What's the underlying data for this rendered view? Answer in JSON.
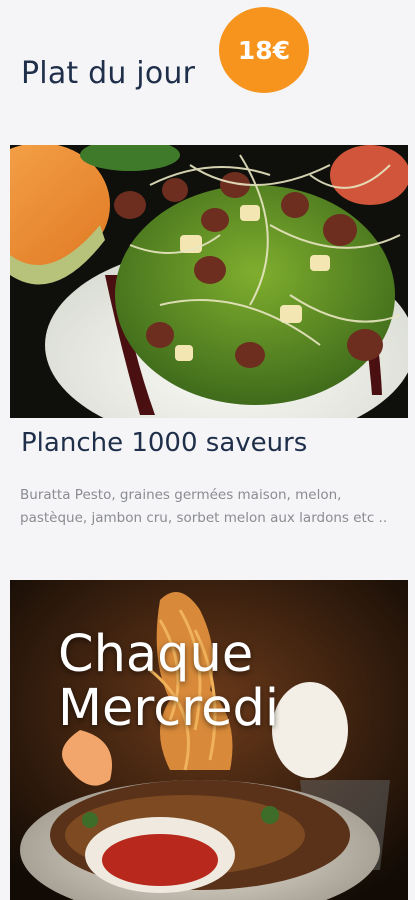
{
  "header": {
    "title": "Plat du jour",
    "price": "18€"
  },
  "dish": {
    "title": "Planche 1000 saveurs",
    "description": "Buratta Pesto, graines germées maison, melon, pastèque, jambon cru, sorbet melon aux lardons etc .."
  },
  "promo": {
    "line1": "Chaque",
    "line2": "Mercredi"
  },
  "colors": {
    "accent": "#f7941d",
    "title": "#1f2f4a",
    "body_text": "#8a8c92",
    "background": "#f5f5f7"
  }
}
